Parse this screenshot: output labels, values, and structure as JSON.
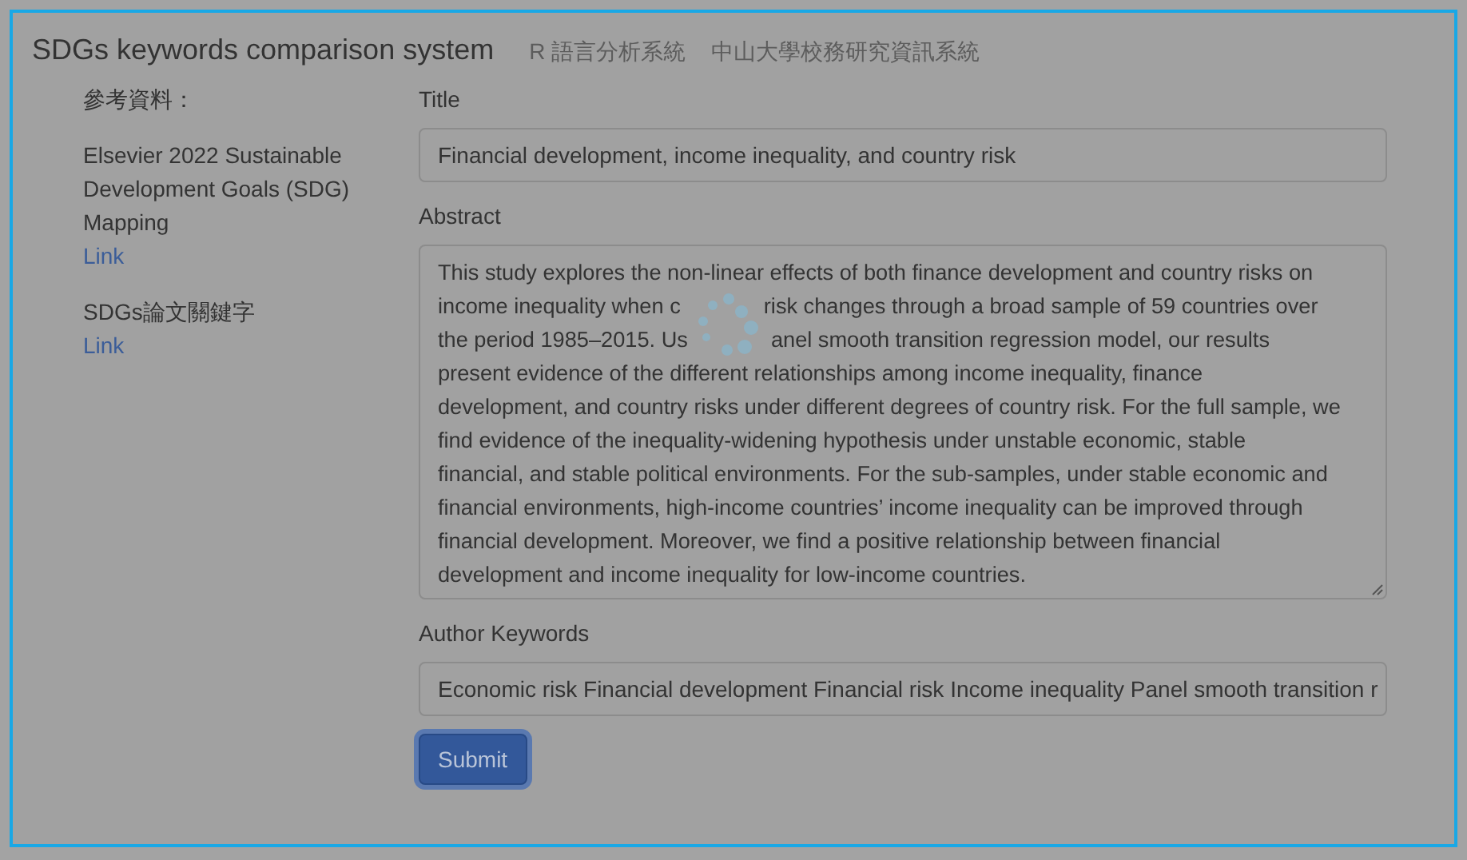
{
  "header": {
    "title": "SDGs keywords comparison system",
    "nav": [
      "R 語言分析系統",
      "中山大學校務研究資訊系統"
    ]
  },
  "sidebar": {
    "heading": "參考資料：",
    "references": [
      {
        "text": "Elsevier 2022 Sustainable Development Goals (SDG) Mapping",
        "link": "Link"
      },
      {
        "text": "SDGs論文關鍵字",
        "link": "Link"
      }
    ]
  },
  "form": {
    "fields": [
      {
        "kind": "input",
        "label": "Title",
        "value": "Financial development, income inequality, and country risk"
      },
      {
        "kind": "textarea",
        "label": "Abstract",
        "lines": [
          [
            "This study explores the non-linear effects of both finance development and country risks on"
          ],
          [
            "income inequality when c",
            "risk changes through a broad sample of 59 countries over"
          ],
          [
            "the period 1985–2015. Us",
            "anel smooth transition regression model, our results"
          ],
          [
            "present evidence of the different relationships among income inequality, finance"
          ],
          [
            "development, and country risks under different degrees of country risk. For the full sample, we"
          ],
          [
            "find evidence of the inequality-widening hypothesis under unstable economic, stable"
          ],
          [
            "financial, and stable political environments. For the sub-samples, under stable economic and"
          ],
          [
            "financial environments, high-income countries’ income inequality can be improved through"
          ],
          [
            "financial development. Moreover, we find a positive relationship between financial"
          ],
          [
            "development and income inequality for low-income countries."
          ]
        ]
      },
      {
        "kind": "input",
        "label": "Author Keywords",
        "value": "Economic risk Financial development Financial risk Income inequality Panel smooth transition r"
      }
    ],
    "submit": {
      "label": "Submit",
      "focused": true
    }
  },
  "loading": true
}
